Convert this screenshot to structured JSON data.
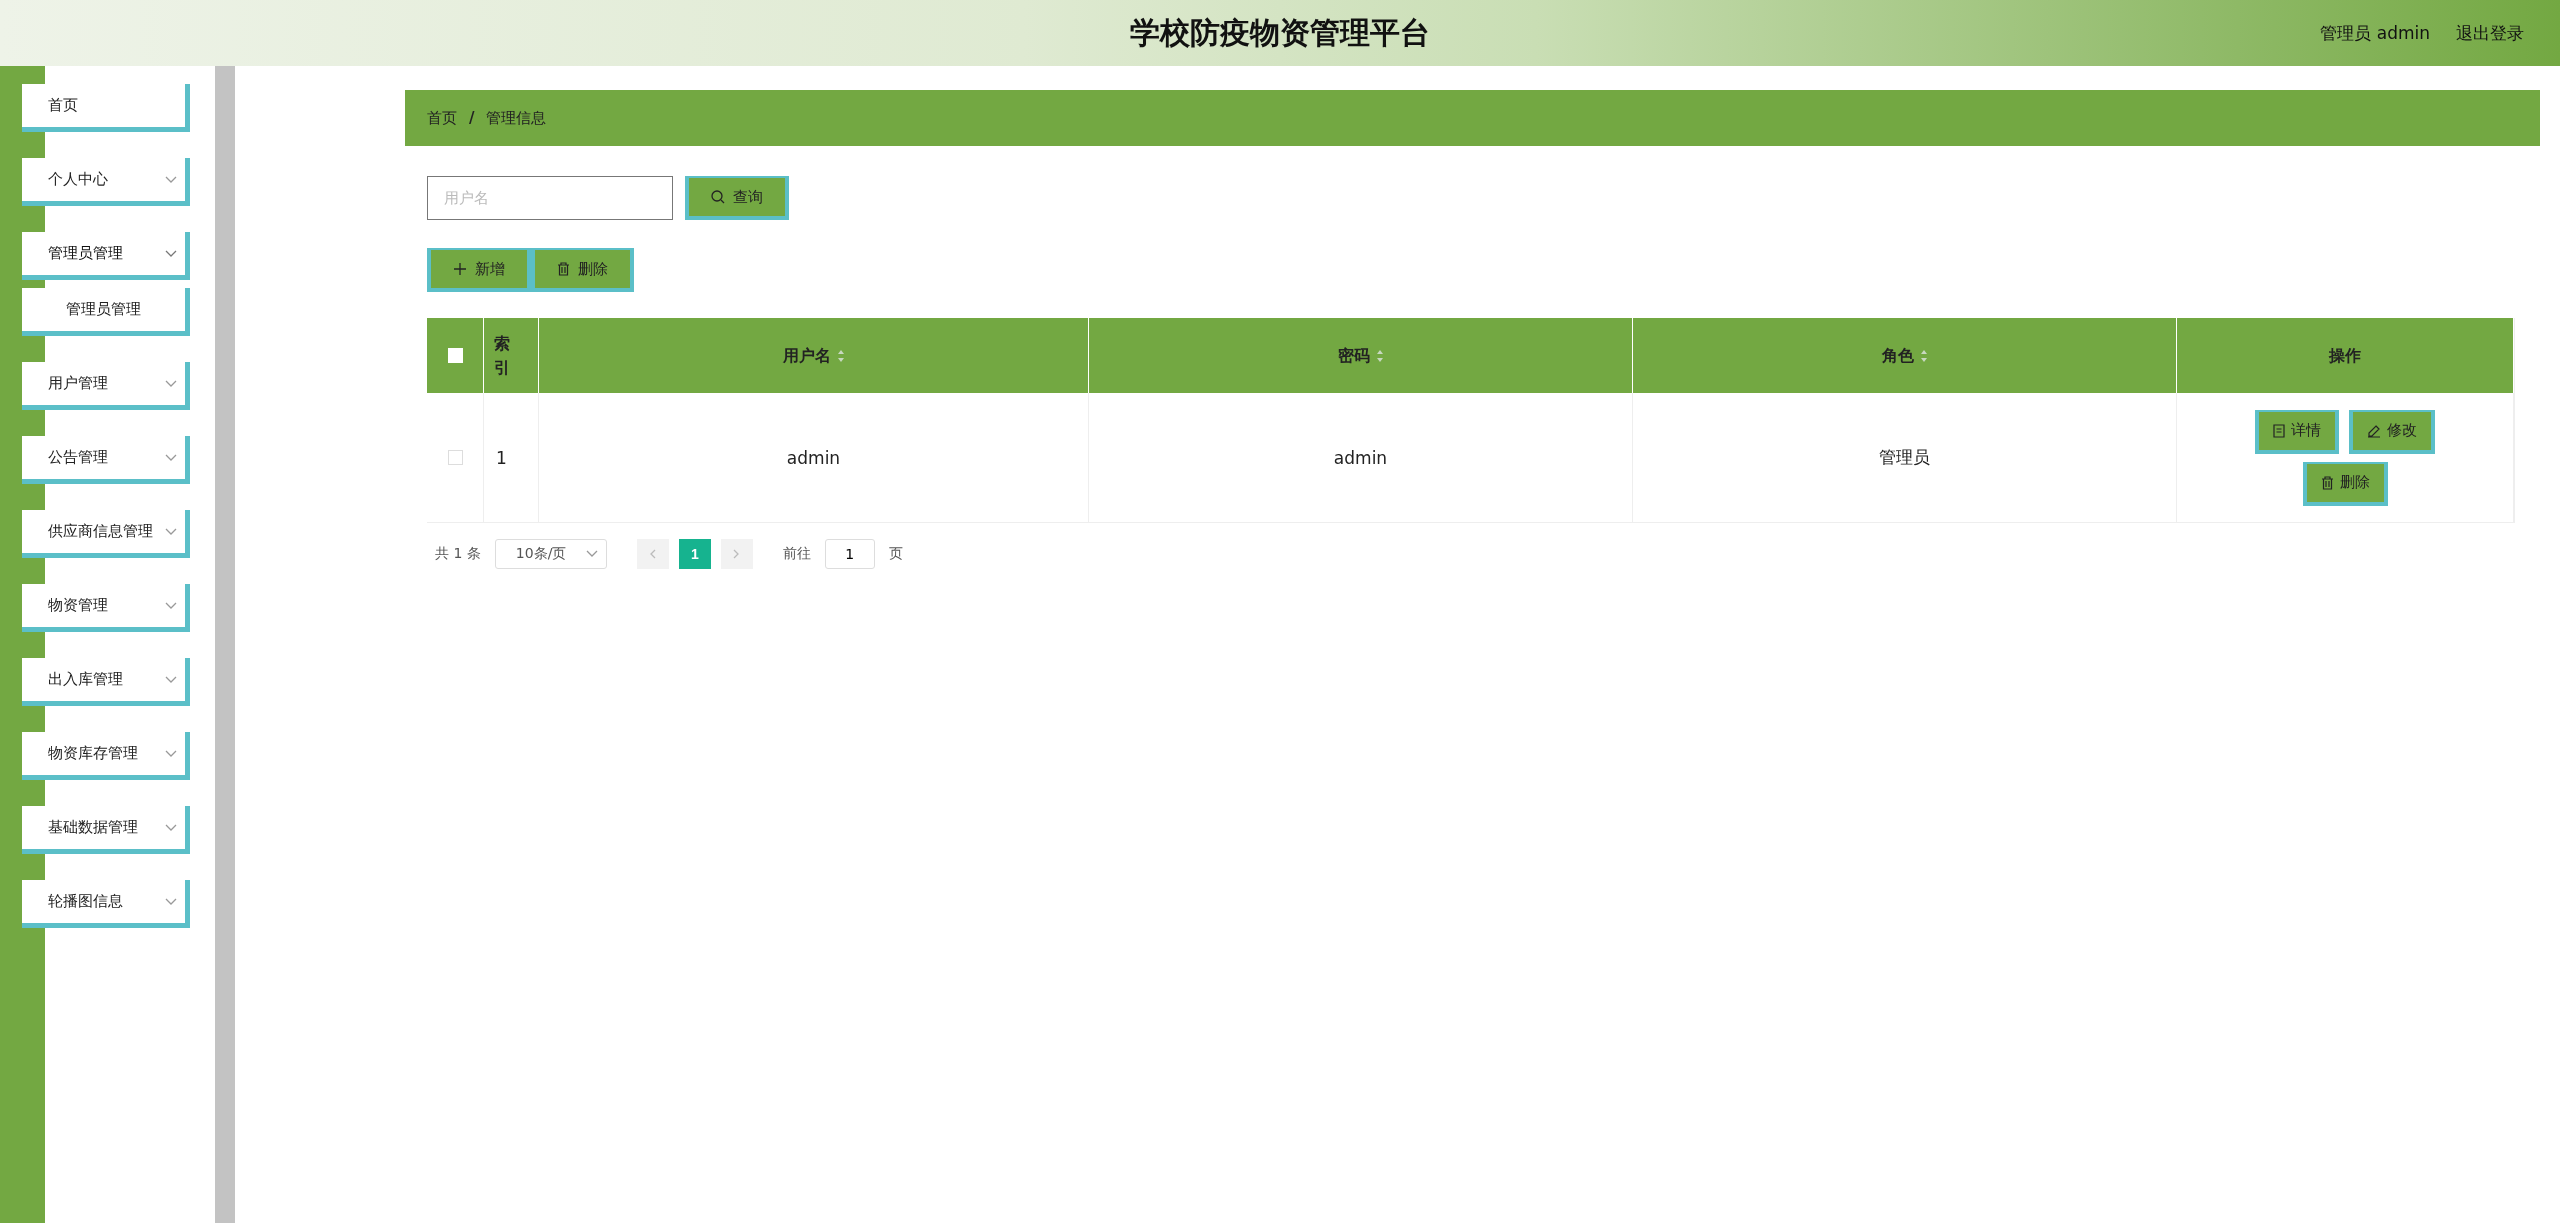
{
  "header": {
    "title": "学校防疫物资管理平台",
    "user": "管理员 admin",
    "logout": "退出登录"
  },
  "sidebar": {
    "items": [
      {
        "label": "首页",
        "expandable": false
      },
      {
        "label": "个人中心",
        "expandable": true
      },
      {
        "label": "管理员管理",
        "expandable": true,
        "expanded": true,
        "children": [
          {
            "label": "管理员管理"
          }
        ]
      },
      {
        "label": "用户管理",
        "expandable": true
      },
      {
        "label": "公告管理",
        "expandable": true
      },
      {
        "label": "供应商信息管理",
        "expandable": true
      },
      {
        "label": "物资管理",
        "expandable": true
      },
      {
        "label": "出入库管理",
        "expandable": true
      },
      {
        "label": "物资库存管理",
        "expandable": true
      },
      {
        "label": "基础数据管理",
        "expandable": true
      },
      {
        "label": "轮播图信息",
        "expandable": true
      }
    ]
  },
  "breadcrumb": {
    "separator": "/",
    "items": [
      "首页",
      "管理信息"
    ]
  },
  "search": {
    "placeholder": "用户名",
    "button": "查询"
  },
  "actions": [
    "新增",
    "删除"
  ],
  "table": {
    "select_all_checked": false,
    "columns": [
      {
        "label": "索引",
        "sortable": false
      },
      {
        "label": "用户名",
        "sortable": true
      },
      {
        "label": "密码",
        "sortable": true
      },
      {
        "label": "角色",
        "sortable": true
      },
      {
        "label": "操作",
        "sortable": false
      }
    ],
    "rows": [
      {
        "checked": false,
        "cells": [
          "1",
          "admin",
          "admin",
          "管理员"
        ],
        "buttons": [
          {
            "kind": "detail",
            "label": "详情"
          },
          {
            "kind": "edit",
            "label": "修改"
          },
          {
            "kind": "delete",
            "label": "删除"
          }
        ]
      }
    ]
  },
  "pagination": {
    "total": "共 1 条",
    "page_size": "10条/页",
    "pages": [
      {
        "label": "1",
        "selected": true
      }
    ],
    "goto_label": "前往",
    "goto_value": "1",
    "page_suffix": "页"
  }
}
